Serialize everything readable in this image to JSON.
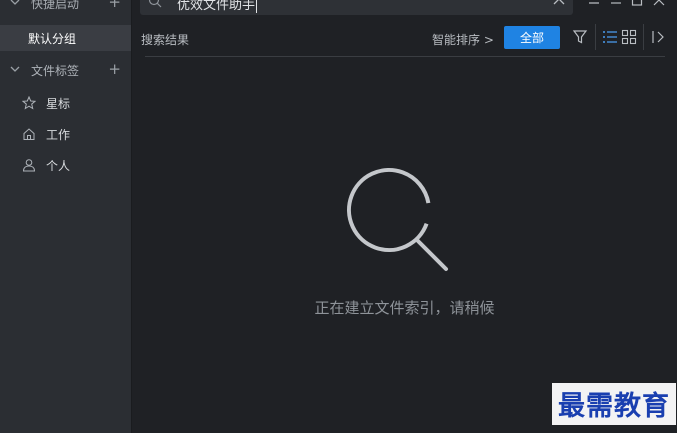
{
  "sidebar": {
    "quick_launch_label": "快捷启动",
    "default_group_label": "默认分组",
    "file_tags_label": "文件标签",
    "tags": [
      {
        "label": "星标",
        "icon": "star-icon"
      },
      {
        "label": "工作",
        "icon": "home-icon"
      },
      {
        "label": "个人",
        "icon": "person-icon"
      }
    ]
  },
  "search": {
    "query": "优效文件助手"
  },
  "toolbar": {
    "results_label": "搜索结果",
    "sort_label": "智能排序 >",
    "all_button_label": "全部"
  },
  "main": {
    "status_text": "正在建立文件索引，请稍候"
  },
  "watermark": {
    "text": "最需教育"
  },
  "colors": {
    "accent": "#1f83e3",
    "sidebar_bg": "#2b2e33",
    "main_bg": "#1f2125"
  }
}
